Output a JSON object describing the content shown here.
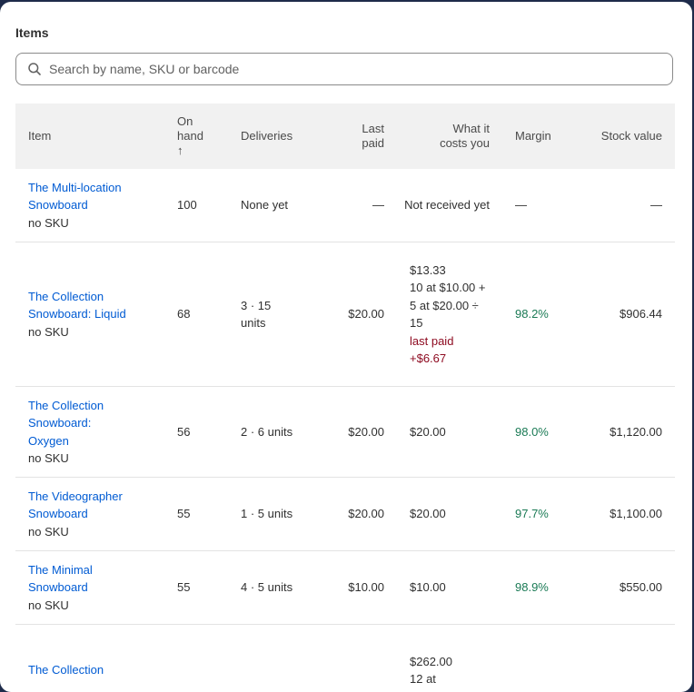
{
  "section_title": "Items",
  "search": {
    "placeholder": "Search by name, SKU or barcode",
    "value": ""
  },
  "columns": {
    "item": "Item",
    "on_hand": "On hand",
    "sort_arrow": "↑",
    "deliveries": "Deliveries",
    "last_paid_1": "Last",
    "last_paid_2": "paid",
    "cost_1": "What it",
    "cost_2": "costs you",
    "margin": "Margin",
    "stock_value": "Stock value"
  },
  "rows": [
    {
      "name": "The Multi-location Snowboard",
      "sku": "no SKU",
      "on_hand": "100",
      "deliveries": "None yet",
      "last_paid": "—",
      "cost_lines": [
        "Not received yet"
      ],
      "cost_note": "",
      "margin": "—",
      "stock_value": "—"
    },
    {
      "name": "The Collection Snowboard: Liquid",
      "sku": "no SKU",
      "on_hand": "68",
      "deliveries": "3 · 15 units",
      "last_paid": "$20.00",
      "cost_lines": [
        "$13.33",
        "10 at $10.00 + 5 at $20.00 ÷ 15"
      ],
      "cost_note": "last paid +$6.67",
      "margin": "98.2%",
      "stock_value": "$906.44"
    },
    {
      "name": "The Collection Snowboard: Oxygen",
      "sku": "no SKU",
      "on_hand": "56",
      "deliveries": "2 · 6 units",
      "last_paid": "$20.00",
      "cost_lines": [
        "$20.00"
      ],
      "cost_note": "",
      "margin": "98.0%",
      "stock_value": "$1,120.00"
    },
    {
      "name": "The Videographer Snowboard",
      "sku": "no SKU",
      "on_hand": "55",
      "deliveries": "1 · 5 units",
      "last_paid": "$20.00",
      "cost_lines": [
        "$20.00"
      ],
      "cost_note": "",
      "margin": "97.7%",
      "stock_value": "$1,100.00"
    },
    {
      "name": "The Minimal Snowboard",
      "sku": "no SKU",
      "on_hand": "55",
      "deliveries": "4 · 5 units",
      "last_paid": "$10.00",
      "cost_lines": [
        "$10.00"
      ],
      "cost_note": "",
      "margin": "98.9%",
      "stock_value": "$550.00"
    },
    {
      "name": "The Collection",
      "sku": "",
      "on_hand": "",
      "deliveries": "",
      "last_paid": "",
      "cost_lines": [
        "$262.00",
        "12 at"
      ],
      "cost_note": "",
      "margin": "",
      "stock_value": ""
    }
  ],
  "colors": {
    "link": "#005bd3",
    "margin_green": "#1a7a55",
    "note_red": "#8e0b21",
    "header_bg": "#f1f1f1"
  }
}
